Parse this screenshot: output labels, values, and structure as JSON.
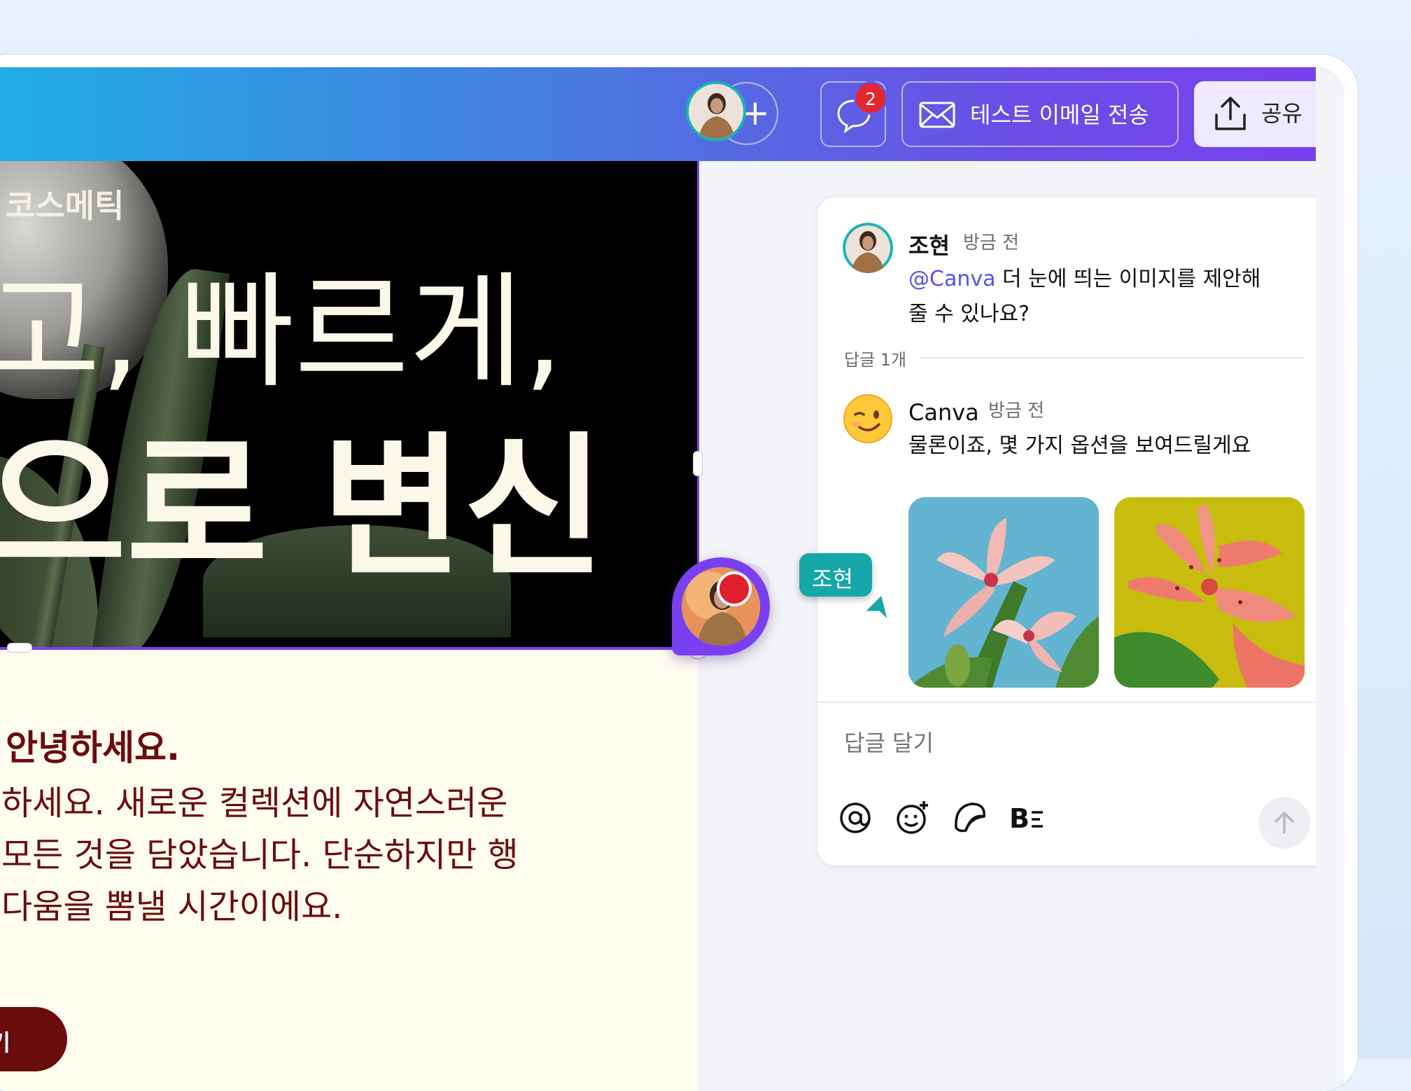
{
  "topbar": {
    "collaborator_count_badge": "2",
    "email_button_label": "테스트 이메일 전송",
    "share_button_label": "공유",
    "add_icon": "plus-icon",
    "comment_icon": "comment-icon",
    "email_icon": "envelope-icon",
    "share_icon": "upload-icon"
  },
  "design": {
    "brand": "코스메틱",
    "hero_line1": "고, 빠르게,",
    "hero_line2": "으로 변신",
    "body_heading": "안녕하세요.",
    "body_lines": [
      "하세요. 새로운 컬렉션에 자연스러운",
      "모든 것을 담았습니다. 단순하지만 행",
      "다움을 뽐낼 시간이에요."
    ],
    "cta_label": "보기"
  },
  "comments": {
    "thread": {
      "author": "조현",
      "time": "방금 전",
      "mention": "@Canva",
      "text_rest": " 더 눈에 띄는 이미지를 제안해",
      "text_line2": "줄 수 있나요?"
    },
    "reply_count": "답글 1개",
    "reply": {
      "author": "Canva",
      "time": "방금 전",
      "text": "물론이죠, 몇 가지 옵션을 보여드릴게요"
    },
    "reply_placeholder": "답글 달기",
    "toolbar_icons": [
      "mention-icon",
      "emoji-add-icon",
      "sticker-icon",
      "format-icon"
    ],
    "send_icon": "arrow-up-icon"
  },
  "cursor_label": "조현",
  "colors": {
    "accent": "#7b3ff2",
    "teal": "#17a7a9",
    "body_text": "#6b0d0d",
    "badge": "#e3282d"
  }
}
